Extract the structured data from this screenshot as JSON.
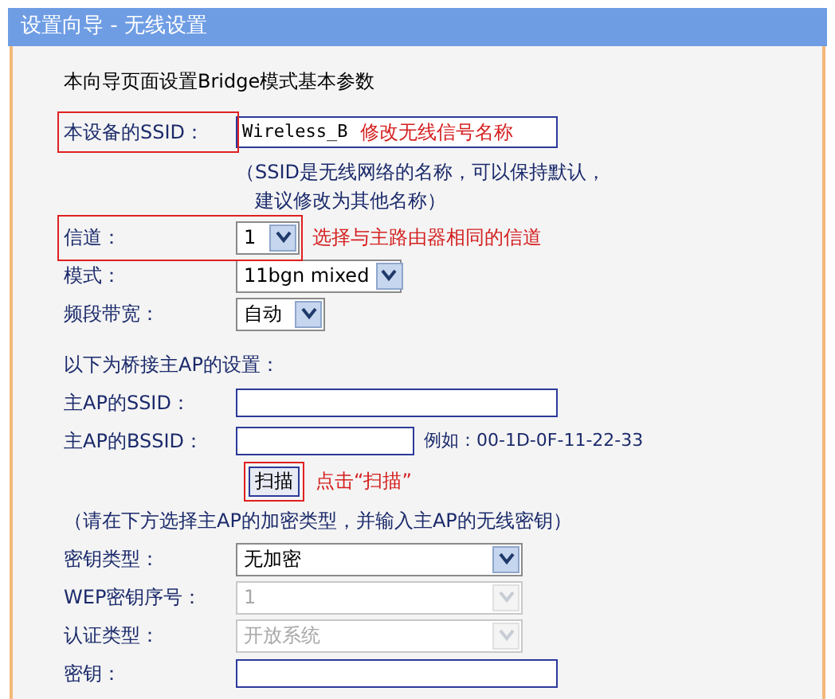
{
  "window": {
    "title": "设置向导 - 无线设置"
  },
  "intro": "本向导页面设置Bridge模式基本参数",
  "ssid": {
    "label": "本设备的SSID：",
    "value": "Wireless_B",
    "annotation": "修改无线信号名称",
    "highlighted": true
  },
  "ssid_note": [
    "（SSID是无线网络的名称，可以保持默认，",
    "建议修改为其他名称）"
  ],
  "channel": {
    "label": "信道：",
    "value": "1",
    "annotation": "选择与主路由器相同的信道",
    "highlighted": true,
    "disabled": false
  },
  "mode": {
    "label": "模式：",
    "value": "11bgn mixed",
    "disabled": false
  },
  "bandwidth": {
    "label": "频段带宽：",
    "value": "自动",
    "disabled": false
  },
  "bridge_heading": "以下为桥接主AP的设置：",
  "ap_ssid": {
    "label": "主AP的SSID："
  },
  "ap_bssid": {
    "label": "主AP的BSSID：",
    "example": "例如：00-1D-0F-11-22-33"
  },
  "scan": {
    "label": "扫描",
    "annotation": "点击“扫描”",
    "highlighted": true
  },
  "encryption_note": "（请在下方选择主AP的加密类型，并输入主AP的无线密钥）",
  "key_type": {
    "label": "密钥类型：",
    "value": "无加密",
    "disabled": false
  },
  "wep_index": {
    "label": "WEP密钥序号：",
    "value": "1",
    "disabled": true
  },
  "auth_type": {
    "label": "认证类型：",
    "value": "开放系统",
    "disabled": true
  },
  "key": {
    "label": "密钥："
  }
}
